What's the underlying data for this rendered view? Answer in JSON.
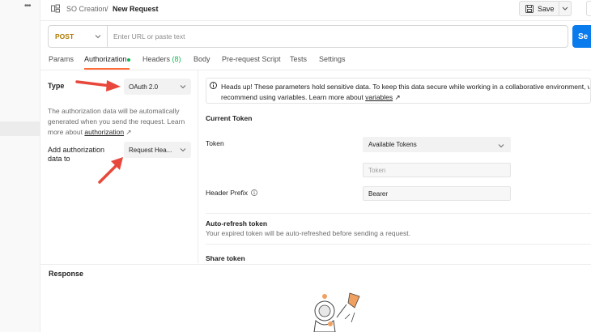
{
  "sidebar": {
    "more_icon": "more-horizontal-icon"
  },
  "breadcrumb": {
    "collection": "SO Creation",
    "separator": "/",
    "request": "New Request",
    "collection_icon": "collection-icon"
  },
  "toolbar": {
    "save_label": "Save",
    "save_icon": "save-icon"
  },
  "request": {
    "method": "POST",
    "url_value": "",
    "url_placeholder": "Enter URL or paste text",
    "send_label": "Se"
  },
  "tabs": [
    {
      "label": "Params"
    },
    {
      "label": "Authorization",
      "active": true,
      "indicator_color": "#0cbb52"
    },
    {
      "label": "Headers",
      "count": "(8)"
    },
    {
      "label": "Body"
    },
    {
      "label": "Pre-request Script"
    },
    {
      "label": "Tests"
    },
    {
      "label": "Settings"
    }
  ],
  "auth": {
    "type_label": "Type",
    "type_value": "OAuth 2.0",
    "description_text": "The authorization data will be automatically generated when you send the request. Learn more about ",
    "description_link": "authorization",
    "description_link_suffix": "↗",
    "add_to_label_1": "Add authorization",
    "add_to_label_2": "data to",
    "add_to_value": "Request Hea..."
  },
  "alert": {
    "text": "Heads up! These parameters hold sensitive data. To keep this data secure while working in a collaborative environment, we",
    "text2": "recommend using variables. Learn more about ",
    "link": "variables",
    "link_suffix": "↗",
    "icon": "info-icon"
  },
  "current_token": {
    "title": "Current Token",
    "token_label": "Token",
    "available_tokens": "Available Tokens",
    "token_placeholder": "Token",
    "header_prefix_label": "Header Prefix",
    "header_prefix_value": "Bearer"
  },
  "auto_refresh": {
    "title": "Auto-refresh token",
    "description": "Your expired token will be auto-refreshed before sending a request."
  },
  "share_token": {
    "title": "Share token"
  },
  "response": {
    "title": "Response"
  },
  "colors": {
    "accent": "#ff6c37",
    "send": "#097bed",
    "method_post": "#ad7a03",
    "annotation_arrow": "#e8473b"
  }
}
